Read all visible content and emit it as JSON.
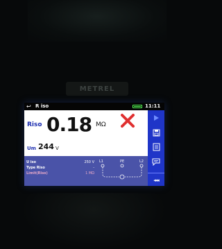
{
  "device": {
    "brand_text": "METREL"
  },
  "status_bar": {
    "title": "R iso",
    "time": "11:11"
  },
  "measurement": {
    "main_label": "Riso",
    "main_value": "0.18",
    "main_unit": "MΩ",
    "result": "fail",
    "voltage_label": "Um",
    "voltage_value": "244",
    "voltage_unit": "V"
  },
  "parameters": [
    {
      "label": "U iso",
      "value": "250 V"
    },
    {
      "label": "Type Riso",
      "value": "-"
    },
    {
      "label": "Limit(Riso)",
      "value": "1 MΩ"
    }
  ],
  "diagram": {
    "left_terminal": "L1",
    "mid_terminal": "PE",
    "right_terminal": "L2"
  },
  "side_buttons": [
    {
      "icon": "play-icon"
    },
    {
      "icon": "save-icon"
    },
    {
      "icon": "list-icon"
    },
    {
      "icon": "comment-icon"
    }
  ],
  "back_button": {
    "label": "◂◂◂"
  },
  "colors": {
    "accent": "#1f35c8",
    "panel": "#4a53a8",
    "fail": "#e03030",
    "limit": "#e8a9c8"
  }
}
